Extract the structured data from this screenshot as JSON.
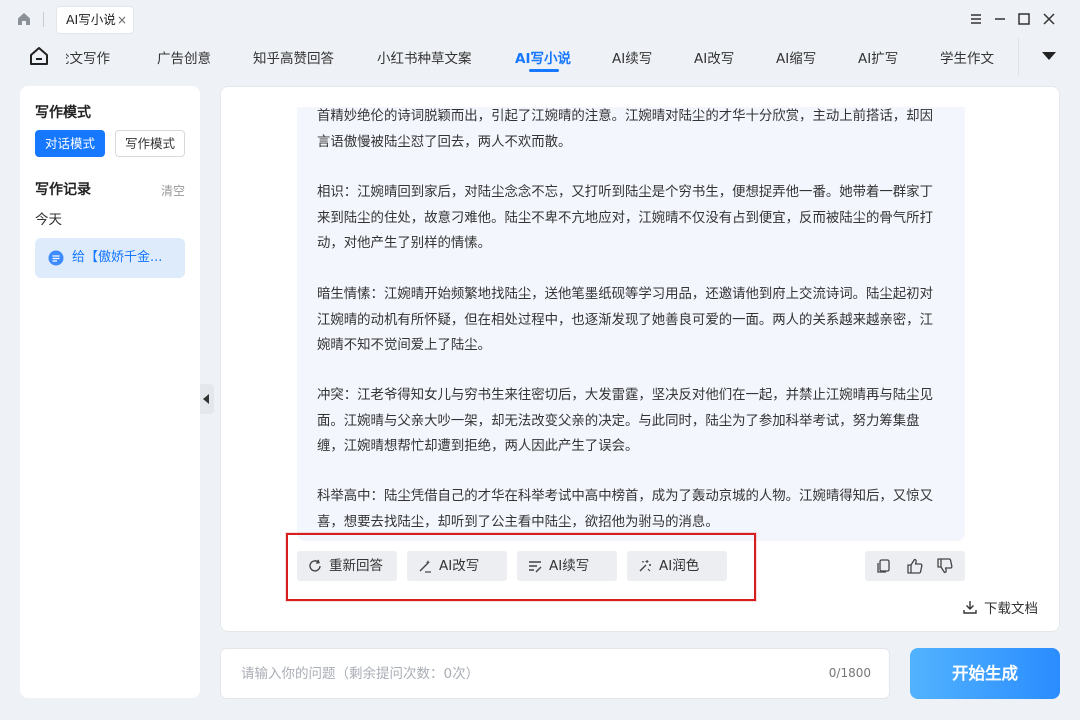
{
  "titlebar": {
    "tab_label": "AI写小说",
    "tab_close": "×"
  },
  "nav": {
    "items": [
      {
        "label": "论文写作"
      },
      {
        "label": "广告创意"
      },
      {
        "label": "知乎高赞回答"
      },
      {
        "label": "小红书种草文案"
      },
      {
        "label": "AI写小说",
        "active": true
      },
      {
        "label": "AI续写"
      },
      {
        "label": "AI改写"
      },
      {
        "label": "AI缩写"
      },
      {
        "label": "AI扩写"
      },
      {
        "label": "学生作文"
      }
    ]
  },
  "sidebar": {
    "mode_title": "写作模式",
    "mode_dialog": "对话模式",
    "mode_write": "写作模式",
    "record_title": "写作记录",
    "clear": "清空",
    "today": "今天",
    "record_item": "给【傲娇千金..."
  },
  "content": {
    "paragraphs": [
      "首精妙绝伦的诗词脱颖而出，引起了江婉晴的注意。江婉晴对陆尘的才华十分欣赏，主动上前搭话，却因言语傲慢被陆尘怼了回去，两人不欢而散。",
      "相识：江婉晴回到家后，对陆尘念念不忘，又打听到陆尘是个穷书生，便想捉弄他一番。她带着一群家丁来到陆尘的住处，故意刁难他。陆尘不卑不亢地应对，江婉晴不仅没有占到便宜，反而被陆尘的骨气所打动，对他产生了别样的情愫。",
      "暗生情愫：江婉晴开始频繁地找陆尘，送他笔墨纸砚等学习用品，还邀请他到府上交流诗词。陆尘起初对江婉晴的动机有所怀疑，但在相处过程中，也逐渐发现了她善良可爱的一面。两人的关系越来越亲密，江婉晴不知不觉间爱上了陆尘。",
      "冲突：江老爷得知女儿与穷书生来往密切后，大发雷霆，坚决反对他们在一起，并禁止江婉晴再与陆尘见面。江婉晴与父亲大吵一架，却无法改变父亲的决定。与此同时，陆尘为了参加科举考试，努力筹集盘缠，江婉晴想帮忙却遭到拒绝，两人因此产生了误会。",
      "科举高中：陆尘凭借自己的才华在科举考试中高中榜首，成为了轰动京城的人物。江婉晴得知后，又惊又喜，想要去找陆尘，却听到了公主看中陆尘，欲招他为驸马的消息。"
    ]
  },
  "actions": {
    "regenerate": "重新回答",
    "rewrite": "AI改写",
    "continue": "AI续写",
    "polish": "AI润色"
  },
  "download": "下载文档",
  "input": {
    "placeholder": "请输入你的问题（剩余提问次数：0次）",
    "counter": "0/1800"
  },
  "generate": "开始生成",
  "colors": {
    "accent": "#1677ff",
    "highlight": "#d61e1e"
  }
}
